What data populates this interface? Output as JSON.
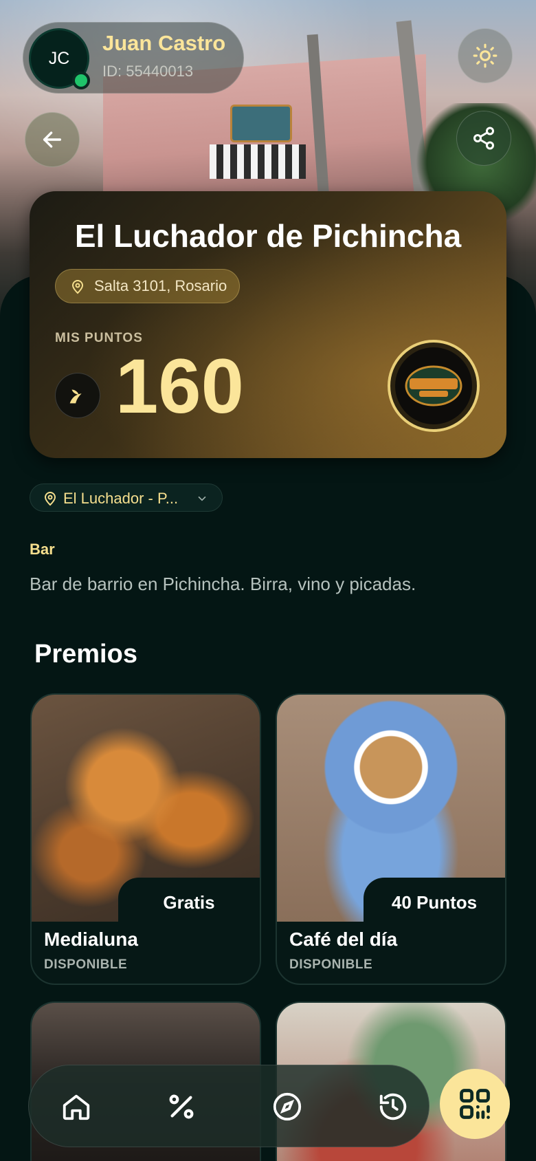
{
  "user": {
    "initials": "JC",
    "name": "Juan Castro",
    "id_label": "ID: 55440013"
  },
  "store": {
    "name": "El Luchador de Pichincha",
    "address": "Salta 3101, Rosario",
    "points_label": "MIS PUNTOS",
    "points": "160",
    "logo_icon": "luchador-logo-icon",
    "branch": "El Luchador - P...",
    "category": "Bar",
    "description": "Bar de barrio en Pichincha. Birra, vino y picadas."
  },
  "rewards": {
    "title": "Premios",
    "items": [
      {
        "name": "Medialuna",
        "price": "Gratis",
        "status": "DISPONIBLE"
      },
      {
        "name": "Café del día",
        "price": "40 Puntos",
        "status": "DISPONIBLE"
      }
    ]
  },
  "nav": {
    "items": [
      "home-icon",
      "percent-icon",
      "compass-icon",
      "history-icon"
    ],
    "qr": "qr-code-icon"
  },
  "colors": {
    "accent": "#fbe59a",
    "background": "#041614",
    "online": "#1fc46a"
  }
}
